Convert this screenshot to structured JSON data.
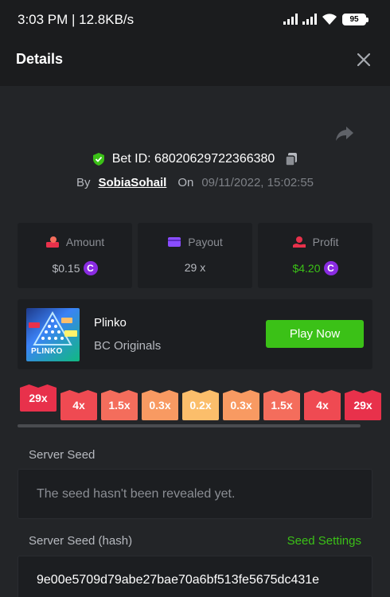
{
  "status_bar": {
    "time": "3:03 PM | 12.8KB/s",
    "battery": "95"
  },
  "header": {
    "title": "Details"
  },
  "bet": {
    "id_label": "Bet ID: 68020629722366380",
    "by_label": "By",
    "user": "SobiaSohail",
    "on_label": "On",
    "date": "09/11/2022, 15:02:55"
  },
  "stats": {
    "amount": {
      "label": "Amount",
      "value": "$0.15"
    },
    "payout": {
      "label": "Payout",
      "value": "29 x"
    },
    "profit": {
      "label": "Profit",
      "value": "$4.20"
    }
  },
  "game": {
    "name": "Plinko",
    "provider": "BC Originals",
    "play_label": "Play Now",
    "thumb_label": "PLINKO"
  },
  "multipliers": [
    {
      "label": "29x",
      "color": "#e8314b"
    },
    {
      "label": "4x",
      "color": "#ef4a52"
    },
    {
      "label": "1.5x",
      "color": "#f46d5c"
    },
    {
      "label": "0.3x",
      "color": "#f89a62"
    },
    {
      "label": "0.2x",
      "color": "#fbbe6b"
    },
    {
      "label": "0.3x",
      "color": "#f89a62"
    },
    {
      "label": "1.5x",
      "color": "#f46d5c"
    },
    {
      "label": "4x",
      "color": "#ef4a52"
    },
    {
      "label": "29x",
      "color": "#e8314b"
    }
  ],
  "seeds": {
    "server_seed_label": "Server Seed",
    "server_seed_value": "The seed hasn't been revealed yet.",
    "server_hash_label": "Server Seed (hash)",
    "seed_settings_label": "Seed Settings",
    "server_hash_value": "9e00e5709d79abe27bae70a6bf513fe5675dc431e"
  },
  "colors": {
    "accent_green": "#3bc117",
    "coin_purple": "#8a2be2",
    "background": "#232528",
    "card": "#1c1e21"
  }
}
